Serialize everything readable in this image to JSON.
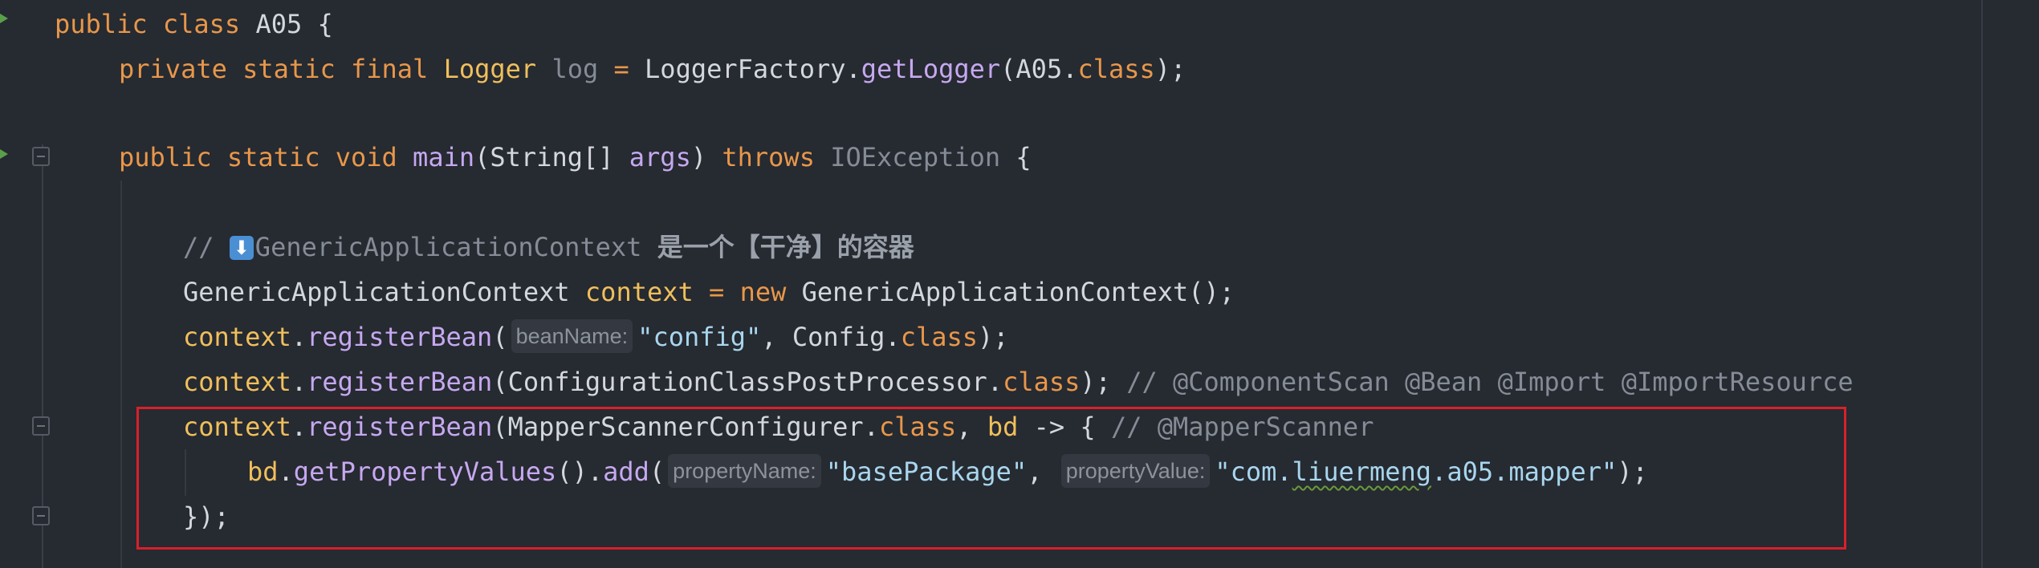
{
  "lines": {
    "l1": {
      "kw": "public class",
      "name": " A05 {"
    },
    "l2": {
      "mods": "private static final",
      "type": "Logger",
      "name": "log",
      "eq": "=",
      "factory": "LoggerFactory.",
      "call": "getLogger",
      "arg_open": "(A05.",
      "arg_class": "class",
      "end": ");"
    },
    "l3": {
      "mods": "public static void",
      "name": "main",
      "params_open": "(String[] ",
      "param": "args",
      "params_close": ")",
      "throws": "throws",
      "exc": "IOException",
      "brace": " {"
    },
    "l4": {
      "slashes": "// ",
      "emoji": "⬇",
      "text": "GenericApplicationContext ",
      "cjk": "是一个【干净】的容器"
    },
    "l5": {
      "type": "GenericApplicationContext ",
      "var": "context",
      "eq": " = ",
      "new": "new",
      "ctor": " GenericApplicationContext();"
    },
    "l6": {
      "var": "context",
      "dot": ".",
      "call": "registerBean",
      "open": "(",
      "hint": "beanName:",
      "str": "\"config\"",
      "mid": ", Config.",
      "cls": "class",
      "end": ");"
    },
    "l7": {
      "var": "context",
      "dot": ".",
      "call": "registerBean",
      "open": "(ConfigurationClassPostProcessor.",
      "cls": "class",
      "end": ");",
      "comment": " // @ComponentScan @Bean @Import @ImportResource"
    },
    "l8": {
      "var": "context",
      "dot": ".",
      "call": "registerBean",
      "open": "(MapperScannerConfigurer.",
      "cls": "class",
      "comma": ", ",
      "param": "bd",
      "arrow": " -> { ",
      "comment": "// @MapperScanner"
    },
    "l9": {
      "var": "bd",
      "dot": ".",
      "call": "getPropertyValues",
      "mid": "().",
      "call2": "add",
      "open": "(",
      "hint1": "propertyName:",
      "str1": "\"basePackage\"",
      "comma": ", ",
      "hint2": "propertyValue:",
      "str2a": "\"com.",
      "str2b": "liuermeng",
      "str2c": ".a05.mapper\"",
      "end": ");"
    },
    "l10": {
      "close": "});"
    }
  }
}
